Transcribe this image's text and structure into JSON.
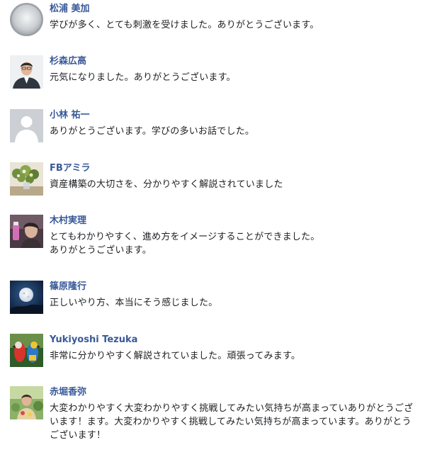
{
  "comments": [
    {
      "name": "松浦 美加",
      "text": "学びが多く、とても刺激を受けました。ありがとうございます。",
      "avatar_icon": "user-photo-icon"
    },
    {
      "name": "杉森広高",
      "text": "元気になりました。ありがとうございます。",
      "avatar_icon": "user-photo-icon"
    },
    {
      "name": "小林 祐一",
      "text": "ありがとうございます。学びの多いお話でした。",
      "avatar_icon": "default-profile-icon"
    },
    {
      "name": "FBアミラ",
      "text": "資産構築の大切さを、分かりやすく解説されていました",
      "avatar_icon": "flowers-photo-icon"
    },
    {
      "name": "木村実理",
      "text": "とてもわかりやすく、進め方をイメージすることができました。\nありがとうございます。",
      "avatar_icon": "user-photo-icon"
    },
    {
      "name": "篠原隆行",
      "text": "正しいやり方、本当にそう感じました。",
      "avatar_icon": "moon-photo-icon"
    },
    {
      "name": "Yukiyoshi Tezuka",
      "text": "非常に分かりやすく解説されていました。頑張ってみます。",
      "avatar_icon": "parrot-photo-icon"
    },
    {
      "name": "赤堀香弥",
      "text": "大変わかりやすく大変わかりやすく挑戦してみたい気持ちが高まっていありがとうございます！ます。大変わかりやすく挑戦してみたい気持ちが高まっています。ありがとうございます！",
      "avatar_icon": "user-photo-icon"
    }
  ],
  "colors": {
    "name_link": "#385898",
    "comment_text": "#1c1e21",
    "default_avatar_bg": "#ccd0d5"
  }
}
